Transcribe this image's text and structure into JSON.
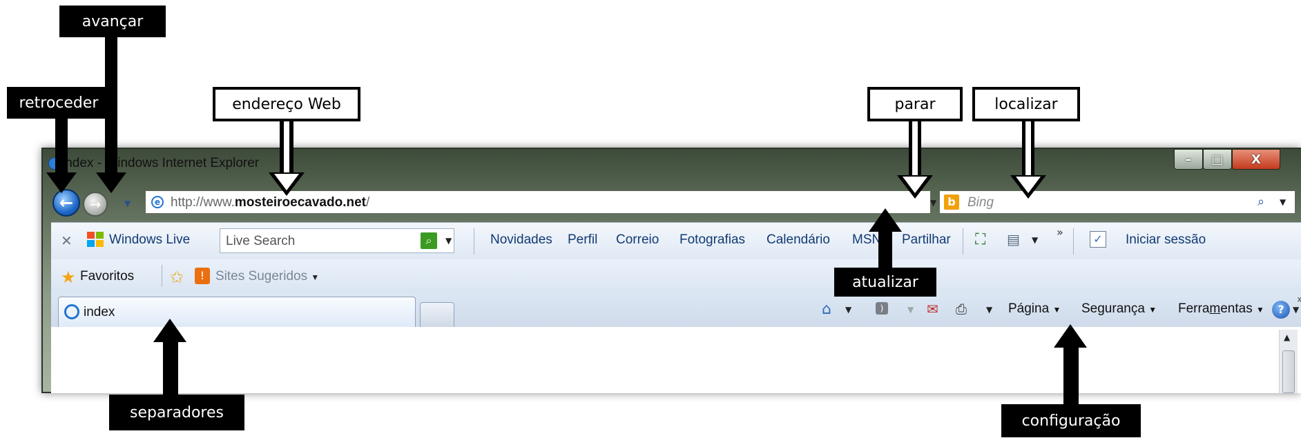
{
  "window": {
    "title": "index - Windows Internet Explorer",
    "min_glyph": "–",
    "max_glyph": "□",
    "close_glyph": "X"
  },
  "nav": {
    "back_glyph": "←",
    "forward_glyph": "→",
    "url_prefix": "http://www.",
    "url_domain": "mosteiroecavado.net",
    "url_suffix": "/",
    "refresh_glyph": "⇆",
    "stop_glyph": "✕",
    "search_placeholder": "Bing",
    "bing_logo": "b"
  },
  "windows_live_bar": {
    "close_glyph": "✕",
    "brand": "Windows Live",
    "search_placeholder": "Live Search",
    "links": [
      "Novidades",
      "Perfil",
      "Correio",
      "Fotografias",
      "Calendário",
      "MSN",
      "Partilhar"
    ],
    "overflow": "»",
    "sign_in": "Iniciar sessão"
  },
  "favorites_bar": {
    "favorites_label": "Favoritos",
    "suggested_sites": "Sites Sugeridos"
  },
  "tabs": {
    "active_label": "index"
  },
  "command_bar": {
    "page": "Página",
    "safety": "Segurança",
    "tools_pre": "Ferra",
    "tools_ul": "m",
    "tools_post": "entas",
    "help_glyph": "?",
    "overflow": "»"
  },
  "callouts": {
    "forward": "avançar",
    "back": "retroceder",
    "address": "endereço Web",
    "stop": "parar",
    "search": "localizar",
    "refresh": "atualizar",
    "tabs": "separadores",
    "settings": "configuração"
  },
  "icons": {
    "back": "back-arrow-icon",
    "forward": "forward-arrow-icon",
    "compatibility": "compatibility-view-icon",
    "refresh": "refresh-icon",
    "stop": "stop-icon",
    "search": "magnifier-icon",
    "home": "home-icon",
    "feeds": "rss-icon",
    "mail": "mail-icon",
    "print": "printer-icon",
    "help": "help-icon"
  },
  "colors": {
    "callout_bg": "#000000",
    "callout_text": "#ffffff",
    "accent_blue": "#1f69c9",
    "stop_red": "#d52121",
    "bing_orange": "#f0a10a"
  }
}
